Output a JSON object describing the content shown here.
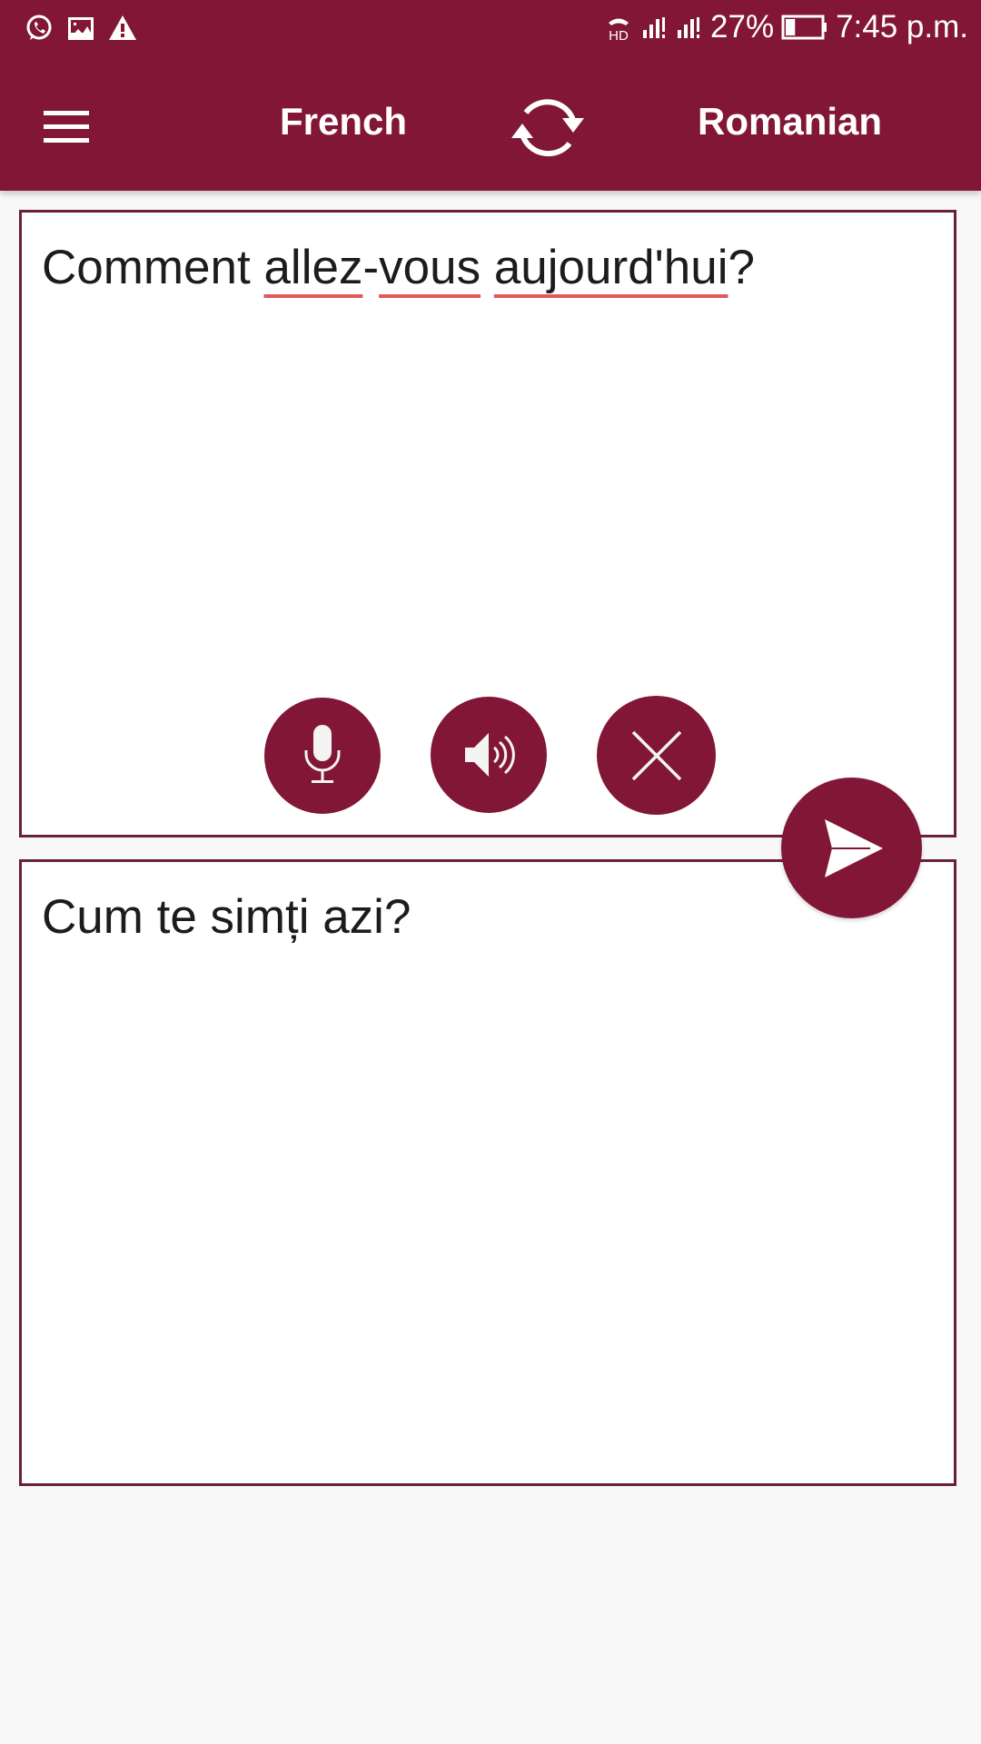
{
  "status_bar": {
    "left_icons": [
      "whatsapp-icon",
      "image-icon",
      "warning-icon"
    ],
    "hd_call_label": "HD",
    "signal_icons": [
      "signal-sim1-icon",
      "signal-sim2-icon"
    ],
    "battery_percent": "27%",
    "battery_level": 0.27,
    "time": "7:45 p.m."
  },
  "toolbar": {
    "menu_icon": "hamburger-menu-icon",
    "source_language": "French",
    "swap_icon": "swap-languages-icon",
    "target_language": "Romanian"
  },
  "input_box": {
    "text_before": "Comment ",
    "words": [
      {
        "text": "allez",
        "misspelled": true
      },
      {
        "text": "-",
        "misspelled": false
      },
      {
        "text": "vous",
        "misspelled": true
      },
      {
        "text": " ",
        "misspelled": false
      },
      {
        "text": "aujourd'hui",
        "misspelled": true
      }
    ],
    "text_after": "?",
    "full_text": "Comment allez-vous aujourd'hui?"
  },
  "actions": {
    "mic": "microphone-icon",
    "speak": "speaker-icon",
    "clear": "close-icon",
    "send": "send-icon"
  },
  "output_box": {
    "text": "Cum te simți azi?"
  },
  "colors": {
    "primary": "#821637",
    "box_border": "#6a1f3c",
    "spellcheck_underline": "#e05a5a",
    "background": "#f8f8f8"
  }
}
